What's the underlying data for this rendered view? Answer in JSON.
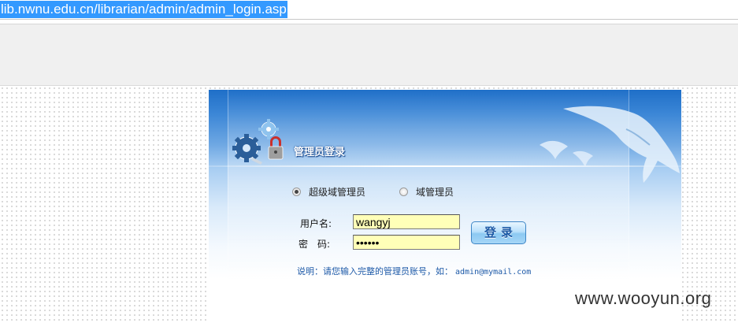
{
  "browser": {
    "url": "lib.nwnu.edu.cn/librarian/admin/admin_login.asp"
  },
  "login": {
    "title": "管理员登录",
    "radio_super": {
      "label": "超级域管理员",
      "checked": true
    },
    "radio_domain": {
      "label": "域管理员",
      "checked": false
    },
    "username_label": "用户名:",
    "username_value": "wangyj",
    "password_label": "密　码:",
    "password_value": "••••••",
    "login_button": "登录",
    "hint_text": "说明：请您输入完整的管理员账号，如：",
    "hint_example": "admin@mymail.com",
    "field_color": "#ffffb8",
    "panel_color": "#2f7fd3"
  },
  "watermark": "www.wooyun.org"
}
